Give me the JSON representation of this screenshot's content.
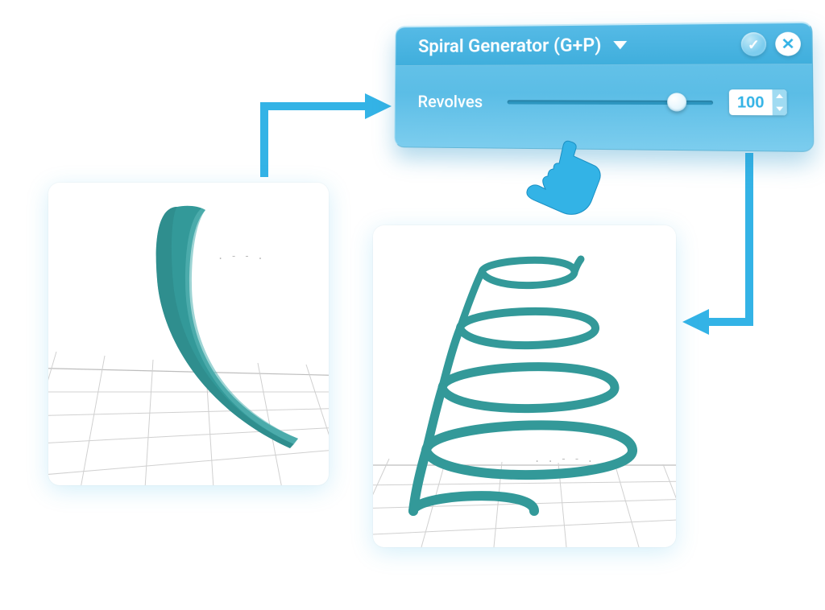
{
  "panel": {
    "title": "Spiral Generator (G+P)",
    "param_label": "Revolves",
    "value": "100",
    "slider_percent": 83,
    "apply_glyph": "✓",
    "close_glyph": "✕"
  },
  "colors": {
    "accent": "#33b3e6",
    "teal": "#339999"
  }
}
